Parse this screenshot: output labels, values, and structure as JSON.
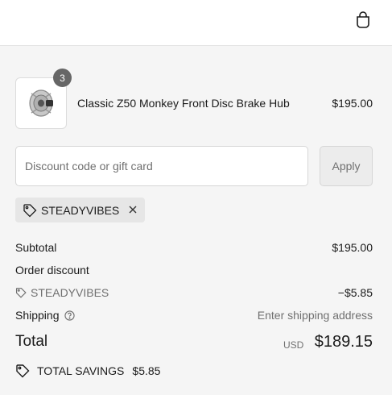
{
  "header": {
    "cart_icon": "shopping-bag-icon"
  },
  "line_item": {
    "quantity": "3",
    "name": "Classic Z50 Monkey Front Disc Brake Hub",
    "price": "$195.00",
    "image": "brake-hub-thumbnail"
  },
  "discount": {
    "placeholder": "Discount code or gift card",
    "value": "",
    "apply_label": "Apply",
    "applied_code": "STEADYVIBES"
  },
  "summary": {
    "subtotal_label": "Subtotal",
    "subtotal_value": "$195.00",
    "order_discount_label": "Order discount",
    "discount_code": "STEADYVIBES",
    "discount_value": "−$5.85",
    "shipping_label": "Shipping",
    "shipping_value": "Enter shipping address",
    "total_label": "Total",
    "currency": "USD",
    "total_value": "$189.15",
    "savings_label": "TOTAL SAVINGS",
    "savings_value": "$5.85"
  },
  "colors": {
    "background": "#f5f5f5",
    "header_bg": "#ffffff",
    "chip_bg": "#e6e6e6",
    "badge_bg": "#666666",
    "muted_text": "#707070"
  }
}
